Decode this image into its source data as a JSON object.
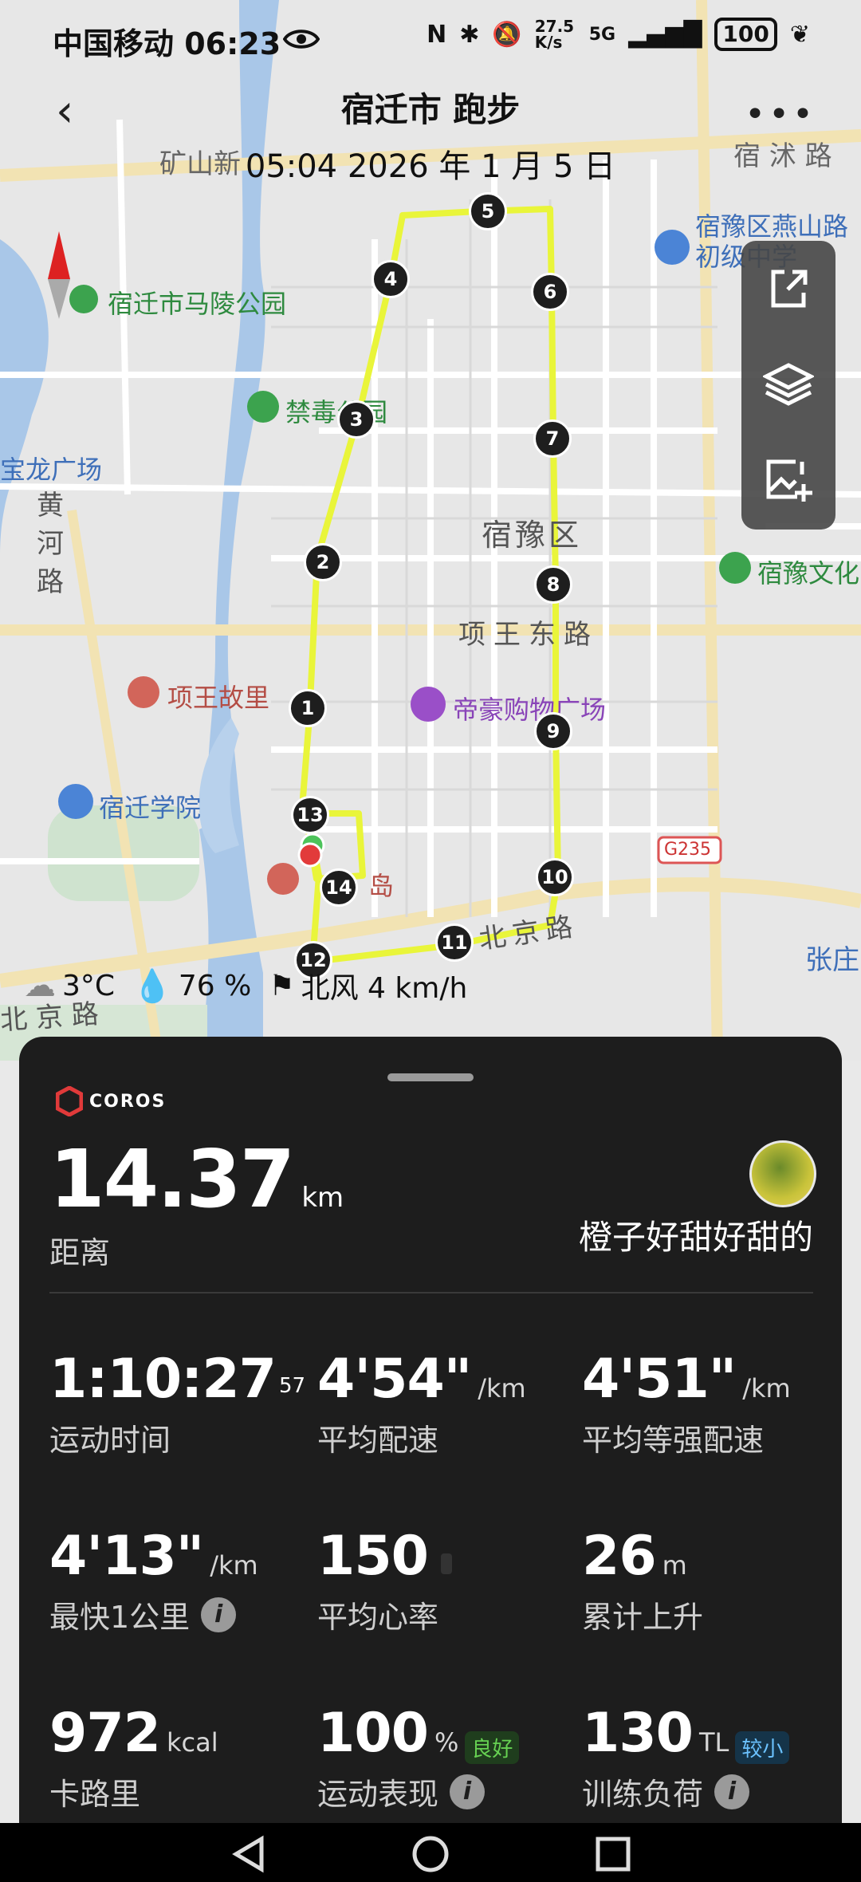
{
  "status_bar": {
    "carrier_time": "中国移动 06:23",
    "net_speed": "27.5 K/s",
    "signal": "5G",
    "battery": "100"
  },
  "header": {
    "title": "宿迁市 跑步",
    "datetime": "05:04 2026 年 1 月 5 日"
  },
  "map": {
    "labels": {
      "road_suhu": "宿 沭 路",
      "school": "宿豫区燕山路初级中学",
      "park_maling": "宿迁市马陵公园",
      "park_jindu": "禁毒公园",
      "baolong": "宝龙广场",
      "yellow_river_road": "黄河路",
      "suyu_district": "宿豫区",
      "suyu_culture": "宿豫文化",
      "xiangwang_east": "项王东路",
      "xiangwang_home": "项王故里",
      "dihao_plaza": "帝豪购物广场",
      "suqian_college": "宿迁学院",
      "island": "岛",
      "g235": "G235",
      "beijing_road": "北京路",
      "beijing_road_2": "北 京 路",
      "zhangzhuang": "张庄",
      "kuangshan": "矿山新"
    },
    "markers": [
      "1",
      "2",
      "3",
      "4",
      "5",
      "6",
      "7",
      "8",
      "9",
      "10",
      "11",
      "12",
      "13",
      "14"
    ]
  },
  "weather": {
    "temp": "3°C",
    "humidity": "76 %",
    "wind": "北风 4 km/h"
  },
  "summary": {
    "brand": "COROS",
    "distance_value": "14.37",
    "distance_unit": "km",
    "distance_label": "距离",
    "username": "橙子好甜好甜的",
    "stats": {
      "time": {
        "value": "1:10:27",
        "sup": "57",
        "label": "运动时间"
      },
      "avg_pace": {
        "value": "4'54\"",
        "unit": "/km",
        "label": "平均配速"
      },
      "avg_gap_pace": {
        "value": "4'51\"",
        "unit": "/km",
        "label": "平均等强配速"
      },
      "fastest_km": {
        "value": "4'13\"",
        "unit": "/km",
        "label": "最快1公里"
      },
      "avg_hr": {
        "value": "150",
        "label": "平均心率"
      },
      "ascent": {
        "value": "26",
        "unit": "m",
        "label": "累计上升"
      },
      "calories": {
        "value": "972",
        "unit": "kcal",
        "label": "卡路里"
      },
      "performance": {
        "value": "100",
        "unit": "%",
        "badge": "良好",
        "label": "运动表现"
      },
      "training_load": {
        "value": "130",
        "unit": "TL",
        "badge": "较小",
        "label": "训练负荷"
      }
    }
  },
  "colors": {
    "route": "#e9f53a",
    "card_bg": "#1d1d1d",
    "badge_good": "#66d152",
    "badge_small": "#6bc2ff"
  }
}
